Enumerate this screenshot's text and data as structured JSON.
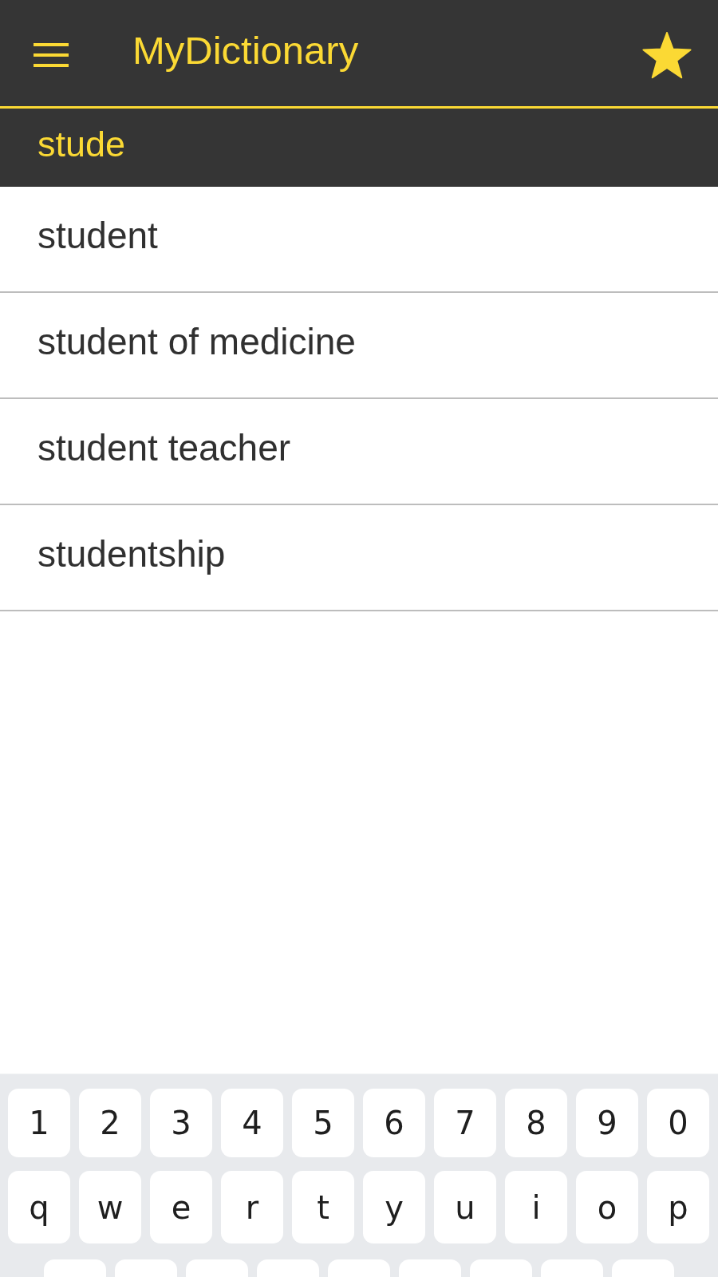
{
  "app_bar": {
    "title": "MyDictionary"
  },
  "search": {
    "value": "stude"
  },
  "suggestions": [
    "student",
    "student of medicine",
    "student teacher",
    "studentship"
  ],
  "keyboard": {
    "rows": [
      [
        "1",
        "2",
        "3",
        "4",
        "5",
        "6",
        "7",
        "8",
        "9",
        "0"
      ],
      [
        "q",
        "w",
        "e",
        "r",
        "t",
        "y",
        "u",
        "i",
        "o",
        "p"
      ]
    ]
  }
}
